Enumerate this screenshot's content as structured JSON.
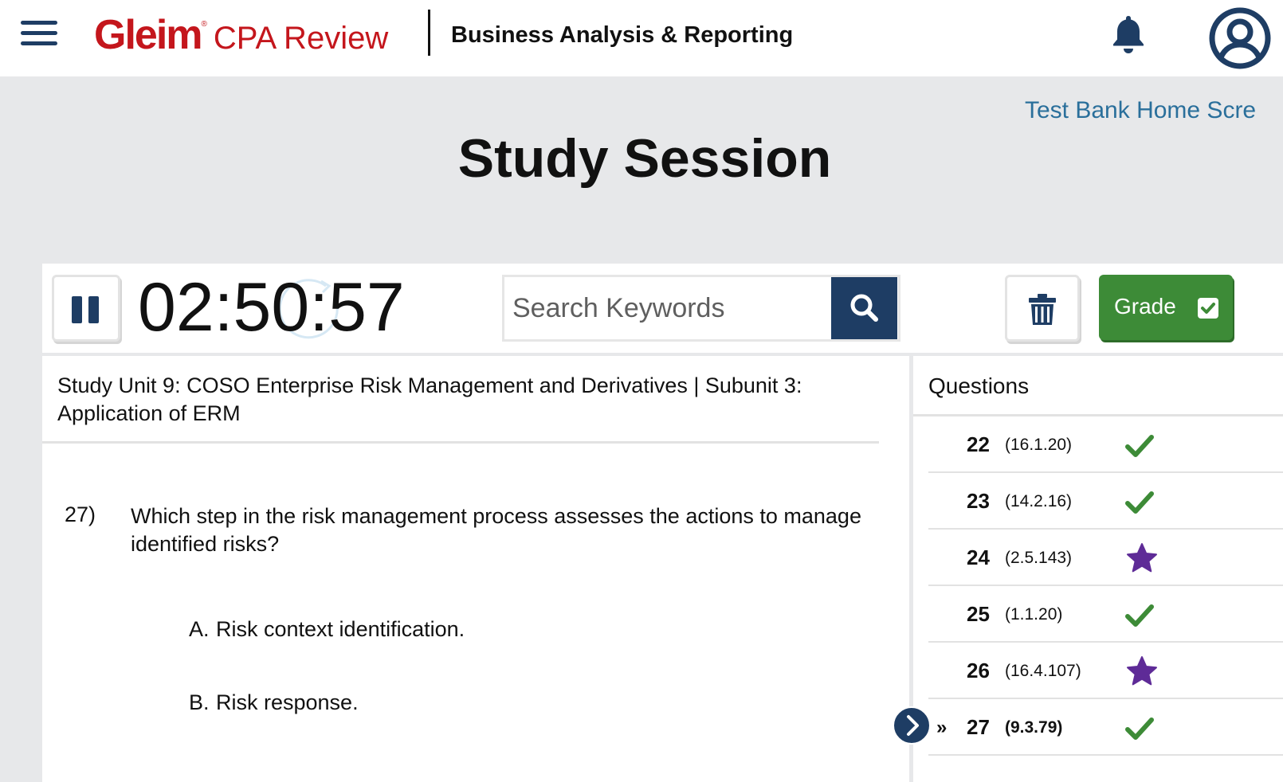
{
  "header": {
    "brand": "Gleim",
    "brand_mark": "®",
    "product": "CPA Review",
    "course": "Business Analysis & Reporting",
    "icons": {
      "menu": "hamburger-menu-icon",
      "notifications": "bell-icon",
      "account": "user-circle-icon"
    },
    "brand_color": "#c4161c"
  },
  "page": {
    "test_bank_link": "Test Bank Home Scre",
    "title": "Study Session"
  },
  "toolbar": {
    "timer": "02:50:57",
    "search_placeholder": "Search Keywords",
    "grade_label": "Grade",
    "accent_color": "#1e3d64",
    "grade_color": "#3d8b37"
  },
  "question": {
    "unit_title": "Study Unit 9: COSO Enterprise Risk Management and Derivatives | Subunit 3: Application of ERM",
    "number": "27)",
    "text": "Which step in the risk management process assesses the actions to manage identified risks?",
    "answers": [
      {
        "letter": "A.",
        "text": "Risk context identification."
      },
      {
        "letter": "B.",
        "text": "Risk response."
      }
    ]
  },
  "questions_panel": {
    "title": "Questions",
    "current_marker": "»",
    "items": [
      {
        "number": "22",
        "ref": "(16.1.20)",
        "status": "check"
      },
      {
        "number": "23",
        "ref": "(14.2.16)",
        "status": "check"
      },
      {
        "number": "24",
        "ref": "(2.5.143)",
        "status": "star"
      },
      {
        "number": "25",
        "ref": "(1.1.20)",
        "status": "check"
      },
      {
        "number": "26",
        "ref": "(16.4.107)",
        "status": "star"
      },
      {
        "number": "27",
        "ref": "(9.3.79)",
        "status": "check",
        "current": true
      }
    ],
    "status_colors": {
      "check": "#3d8b37",
      "star": "#5e2b97"
    }
  }
}
